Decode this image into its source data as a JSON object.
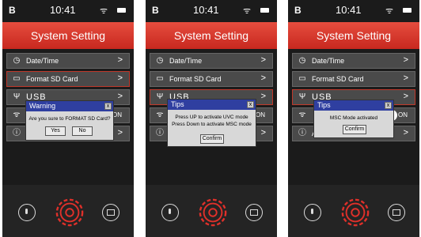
{
  "status": {
    "left_glyph": "B",
    "time": "10:41",
    "wifi_icon": "wifi-icon",
    "battery_icon": "battery-icon"
  },
  "header": {
    "title": "System Setting"
  },
  "menu": {
    "items": [
      {
        "label": "Date/Time",
        "icon": "clock-icon",
        "chevron": ">"
      },
      {
        "label": "Format SD Card",
        "icon": "sd-card-icon",
        "chevron": ">"
      },
      {
        "label": "USB",
        "icon": "usb-icon",
        "chevron": ">"
      },
      {
        "label": "",
        "icon": "wifi-icon",
        "toggle": "ON"
      },
      {
        "label": "A",
        "icon": "info-icon",
        "chevron": ">"
      }
    ]
  },
  "dialogs": {
    "warning": {
      "title": "Warning",
      "message": "Are you sure to FORMAT SD Card?",
      "yes": "Yes",
      "no": "No",
      "close": "x"
    },
    "tips_usb": {
      "title": "Tips",
      "line1": "Press UP to activate UVC mode",
      "line2": "Press Down to activate MSC mode",
      "confirm": "Confirm",
      "close": "x"
    },
    "tips_msc": {
      "title": "Tips",
      "message": "MSC Mode activated",
      "confirm": "Confirm",
      "close": "x"
    }
  },
  "bottom_nav": {
    "left_icon": "thermometer-icon",
    "center_icon": "gear-icon",
    "right_icon": "video-icon"
  },
  "colors": {
    "accent": "#d53a2e",
    "dialog_title_bg": "#2f3fa0",
    "panel_bg": "#1b1b1b"
  }
}
